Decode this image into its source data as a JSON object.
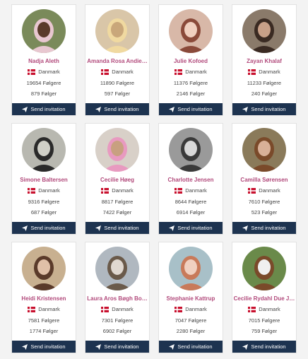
{
  "colors": {
    "name": "#b24b7c",
    "button_bg": "#1d3350",
    "flag_red": "#c8102e"
  },
  "button_label": "Send invitation",
  "button_icon": "paper-plane-icon",
  "followers_suffix": "Følgere",
  "following_suffix": "Følger",
  "profiles": [
    {
      "name": "Nadja Aleth",
      "country": "Danmark",
      "followers": "19654 Følgere",
      "following": "879 Følger"
    },
    {
      "name": "Amanda Rosa Andie…",
      "country": "Danmark",
      "followers": "11890 Følgere",
      "following": "597 Følger"
    },
    {
      "name": "Julie Kofoed",
      "country": "Danmark",
      "followers": "11376 Følgere",
      "following": "2146 Følger"
    },
    {
      "name": "Zayan Khalaf",
      "country": "Danmark",
      "followers": "11233 Følgere",
      "following": "240 Følger"
    },
    {
      "name": "Simone Baltersen",
      "country": "Danmark",
      "followers": "9316 Følgere",
      "following": "687 Følger"
    },
    {
      "name": "Cecilie Høeg",
      "country": "Danmark",
      "followers": "8817 Følgere",
      "following": "7422 Følger"
    },
    {
      "name": "Charlotte Jensen",
      "country": "Danmark",
      "followers": "8644 Følgere",
      "following": "6914 Følger"
    },
    {
      "name": "Camilla Sørensen",
      "country": "Danmark",
      "followers": "7610 Følgere",
      "following": "523 Følger"
    },
    {
      "name": "Heidi Kristensen",
      "country": "Danmark",
      "followers": "7581 Følgere",
      "following": "1774 Følger"
    },
    {
      "name": "Laura Aros Bøgh Bo…",
      "country": "Danmark",
      "followers": "7301 Følgere",
      "following": "6902 Følger"
    },
    {
      "name": "Stephanie Kattrup",
      "country": "Danmark",
      "followers": "7047 Følgere",
      "following": "2280 Følger"
    },
    {
      "name": "Cecilie Rydahl Due J…",
      "country": "Danmark",
      "followers": "7015 Følgere",
      "following": "759 Følger"
    }
  ]
}
